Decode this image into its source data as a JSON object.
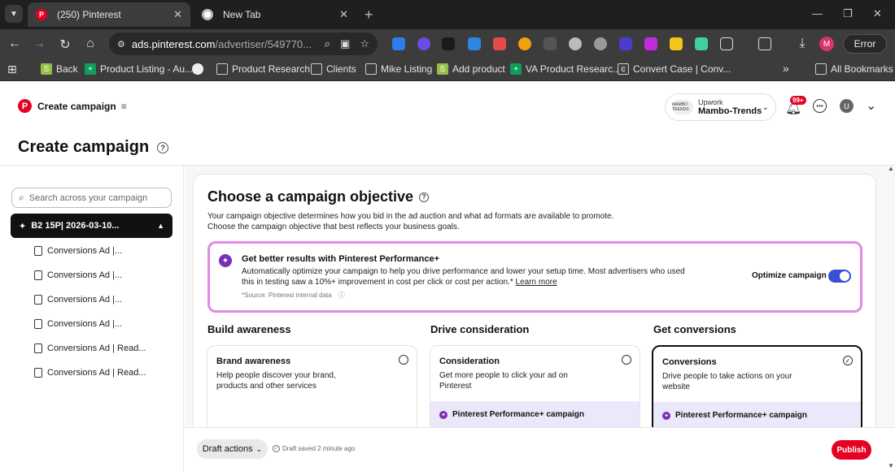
{
  "browser": {
    "tabs": [
      {
        "title": "(250) Pinterest",
        "active": true
      },
      {
        "title": "New Tab",
        "active": false
      }
    ],
    "url_host": "ads.pinterest.com",
    "url_path": "/advertiser/549770...",
    "error_label": "Error",
    "profile_initial": "M",
    "bookmarks": [
      {
        "label": "Back",
        "icon": "shopify-icon"
      },
      {
        "label": "Product Listing - Au...",
        "icon": "sheets-icon"
      },
      {
        "label": "",
        "icon": "globe-icon"
      },
      {
        "label": "Product Research",
        "icon": "folder-icon"
      },
      {
        "label": "Clients",
        "icon": "folder-icon"
      },
      {
        "label": "Mike Listing",
        "icon": "folder-icon"
      },
      {
        "label": "Add product",
        "icon": "shopify-icon"
      },
      {
        "label": "VA Product Researc...",
        "icon": "sheets-icon"
      },
      {
        "label": "Convert Case | Conv...",
        "icon": "convertcase-icon"
      }
    ],
    "more_bookmarks": "»",
    "all_bookmarks": "All Bookmarks"
  },
  "header": {
    "brand_label": "Create campaign",
    "account_sub": "Upwork",
    "account_name": "Mambo-Trends",
    "account_logo_text": "MAMBO TRENDS",
    "notif_badge": "99+",
    "user_initial": "U"
  },
  "page_title": "Create campaign",
  "sidebar": {
    "search_placeholder": "Search across your campaign",
    "campaign_label": "B2 15P| 2026-03-10...",
    "ads": [
      "Conversions Ad |...",
      "Conversions Ad |...",
      "Conversions Ad |...",
      "Conversions Ad |...",
      "Conversions Ad | Read...",
      "Conversions Ad | Read..."
    ]
  },
  "objective": {
    "title": "Choose a campaign objective",
    "desc_line1": "Your campaign objective determines how you bid in the ad auction and what ad formats are available to promote.",
    "desc_line2": "Choose the campaign objective that best reflects your business goals."
  },
  "performance": {
    "title": "Get better results with Pinterest Performance+",
    "desc": "Automatically optimize your campaign to help you drive performance and lower your setup time. Most advertisers who used this in testing saw a 10%+ improvement in cost per click or cost per action.*",
    "learn_more": "Learn more",
    "source": "*Source: Pinterest internal data",
    "optimize_label": "Optimize campaign",
    "toggle_on": true,
    "accent": "#e28ae6",
    "toggle_color": "#3750d6"
  },
  "groups": [
    {
      "title": "Build awareness",
      "card_title": "Brand awareness",
      "card_desc": "Help people discover your brand, products and other services",
      "selected": false,
      "perf_tag": ""
    },
    {
      "title": "Drive consideration",
      "card_title": "Consideration",
      "card_desc": "Get more people to click your ad on Pinterest",
      "selected": false,
      "perf_tag": "Pinterest Performance+ campaign"
    },
    {
      "title": "Get conversions",
      "card_title": "Conversions",
      "card_desc": "Drive people to take actions on your website",
      "selected": true,
      "perf_tag": "Pinterest Performance+ campaign"
    }
  ],
  "footer": {
    "draft_actions": "Draft actions",
    "saved_text": "Draft saved 2 minute ago",
    "publish": "Publish",
    "publish_color": "#e60023"
  }
}
